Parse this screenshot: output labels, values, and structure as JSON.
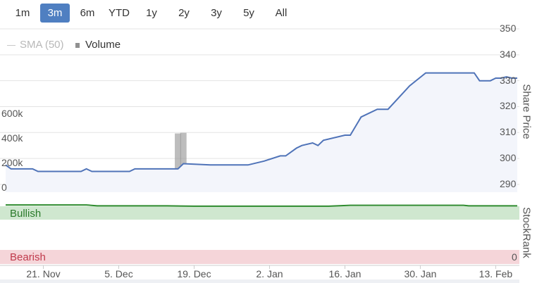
{
  "ranges": [
    {
      "label": "1m",
      "active": false
    },
    {
      "label": "3m",
      "active": true
    },
    {
      "label": "6m",
      "active": false
    },
    {
      "label": "YTD",
      "active": false
    },
    {
      "label": "1y",
      "active": false
    },
    {
      "label": "2y",
      "active": false
    },
    {
      "label": "3y",
      "active": false
    },
    {
      "label": "5y",
      "active": false
    },
    {
      "label": "All",
      "active": false
    }
  ],
  "legend": {
    "sma": "SMA (50)",
    "volume": "Volume"
  },
  "colors": {
    "price_line": "#4f73b8",
    "price_fill": "#f3f5fb",
    "volume": "#9a9a9a",
    "active_button": "#4f7fc1",
    "bullish_zone": "#cfe7cf",
    "bullish_text": "#2a7a2a",
    "stockrank_line": "#2e8b2e",
    "bearish_zone": "#f5d5d9",
    "bearish_text": "#c0394b"
  },
  "chart_data": [
    {
      "type": "line",
      "ylabel": "Share Price",
      "ylim": [
        287,
        350
      ],
      "y_ticks": [
        290,
        300,
        310,
        320,
        330,
        340,
        350
      ],
      "x_ticks": [
        "21. Nov",
        "5. Dec",
        "19. Dec",
        "2. Jan",
        "16. Jan",
        "30. Jan",
        "13. Feb"
      ],
      "x_tick_days": [
        7,
        21,
        35,
        49,
        63,
        77,
        91
      ],
      "x_range": [
        0,
        95
      ],
      "grid": true,
      "series": [
        {
          "x": [
            0,
            1,
            5,
            6,
            14,
            15,
            16,
            23,
            24,
            32,
            33,
            38,
            43,
            45,
            48,
            51,
            52,
            54,
            55,
            57,
            58,
            59,
            63,
            64,
            66,
            69,
            70,
            71,
            75,
            78,
            79,
            81,
            82,
            84,
            85,
            86,
            87,
            88,
            90,
            91,
            92,
            93,
            94,
            95
          ],
          "y": [
            297.5,
            296,
            296,
            295,
            295,
            296,
            295,
            295,
            296,
            296,
            298,
            297.5,
            297.5,
            297.5,
            299,
            301,
            301,
            304,
            305,
            306,
            305,
            307,
            309,
            309,
            316,
            319,
            319,
            319,
            328,
            333,
            333,
            333,
            333,
            333,
            333,
            333,
            333,
            330,
            330,
            331,
            331,
            331.5,
            331,
            331
          ]
        }
      ]
    },
    {
      "type": "bar",
      "title": "Volume",
      "y_ticks": [
        "0",
        "200k",
        "400k",
        "600k"
      ],
      "ylim": [
        0,
        700000
      ],
      "x": [
        5,
        8,
        9,
        12,
        17,
        30,
        32,
        33,
        42,
        43,
        44,
        45,
        51,
        69,
        71,
        72,
        74,
        76,
        77,
        80,
        84,
        86
      ],
      "values": [
        8000,
        6000,
        6000,
        12000,
        14000,
        10000,
        475000,
        480000,
        6000,
        6000,
        10000,
        18000,
        6000,
        14000,
        10000,
        10000,
        6000,
        10000,
        6000,
        6000,
        6000,
        10000
      ]
    },
    {
      "type": "line",
      "ylabel": "StockRank",
      "zones": [
        "Bullish",
        "Bearish"
      ],
      "bearish_value_label": "0",
      "ylim": [
        0,
        100
      ],
      "series": [
        {
          "x": [
            0,
            5,
            10,
            15,
            17,
            20,
            25,
            30,
            35,
            40,
            45,
            50,
            55,
            60,
            64,
            70,
            75,
            80,
            85,
            86,
            90,
            95
          ],
          "y": [
            97.5,
            97.5,
            97.5,
            97.5,
            96,
            96,
            96,
            96,
            95.5,
            95.5,
            95.5,
            95.5,
            95.5,
            95.5,
            97,
            97,
            97,
            97,
            97,
            96,
            96,
            96
          ]
        }
      ]
    }
  ]
}
